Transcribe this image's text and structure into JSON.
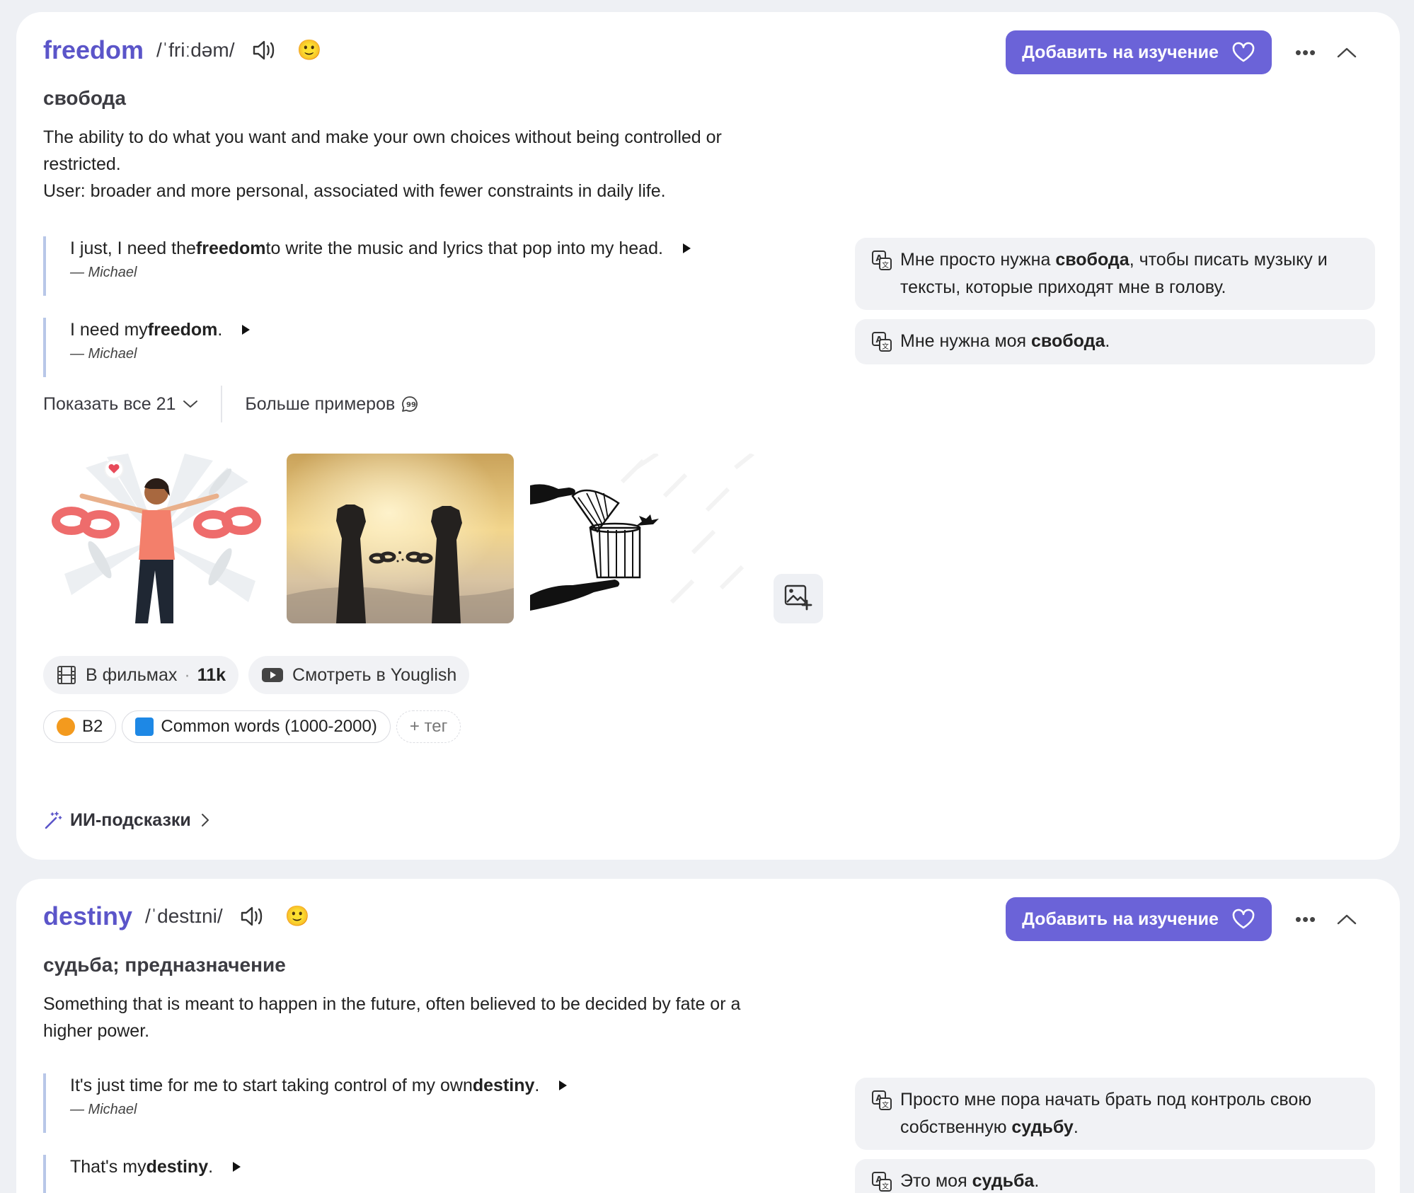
{
  "cards": [
    {
      "word": "freedom",
      "ipa": "/ˈfriːdəm/",
      "emoji": "🙂",
      "add_button": "Добавить на изучение",
      "translation": "свобода",
      "definition_lines": [
        "The ability to do what you want and make your own choices without being controlled or",
        "restricted.",
        "User: broader and more personal, associated with fewer constraints in daily life."
      ],
      "examples": [
        {
          "pre": "I just, I need the ",
          "bold": "freedom",
          "post": " to write the music and lyrics that pop into my head.",
          "author": "— Michael",
          "tr_pre": "Мне просто нужна ",
          "tr_bold": "свобода",
          "tr_post": ", чтобы писать музыку и тексты, которые приходят мне в голову."
        },
        {
          "pre": "I need my ",
          "bold": "freedom",
          "post": ".",
          "author": "— Michael",
          "tr_pre": "Мне нужна моя ",
          "tr_bold": "свобода",
          "tr_post": "."
        }
      ],
      "show_all": "Показать все 21",
      "more_examples": "Больше примеров",
      "chips": {
        "movies": "В фильмах",
        "movies_count": "11k",
        "youglish": "Смотреть в Youglish"
      },
      "tags": {
        "level": "B2",
        "list": "Common words (1000-2000)",
        "add": "+ тег"
      },
      "ai_hints": "ИИ-подсказки"
    },
    {
      "word": "destiny",
      "ipa": "/ˈdestɪni/",
      "emoji": "🙂",
      "add_button": "Добавить на изучение",
      "translation": "судьба; предназначение",
      "definition_lines": [
        "Something that is meant to happen in the future, often believed to be decided by fate or a",
        "higher power."
      ],
      "examples": [
        {
          "pre": "It's just time for me to start taking control of my own ",
          "bold": "destiny",
          "post": ".",
          "author": "— Michael",
          "tr_pre": "Просто мне пора начать брать под контроль свою собственную ",
          "tr_bold": "судьбу",
          "tr_post": "."
        },
        {
          "pre": "That's my ",
          "bold": "destiny",
          "post": ".",
          "author": "",
          "tr_pre": "Это моя ",
          "tr_bold": "судьба",
          "tr_post": "."
        }
      ]
    }
  ],
  "colors": {
    "accent": "#6b63d8",
    "word": "#5b55c9",
    "quote_bar": "#b8c7e8",
    "panel": "#f1f2f5"
  },
  "icons": [
    "speaker-icon",
    "heart-icon",
    "more-icon",
    "chevron-up-icon",
    "play-icon",
    "translate-icon",
    "chevron-down-icon",
    "chat-bubble-icon",
    "film-icon",
    "youtube-icon",
    "add-image-icon",
    "magic-wand-icon",
    "chevron-right-icon"
  ]
}
